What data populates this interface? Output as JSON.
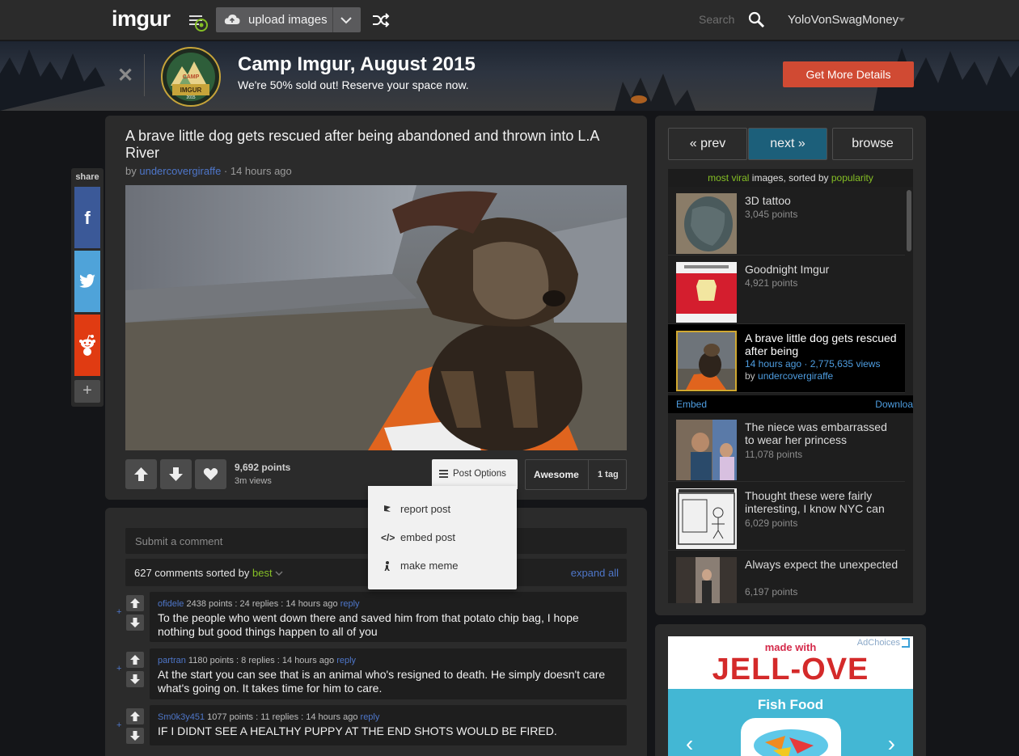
{
  "header": {
    "logo": "imgur",
    "upload_label": "upload images",
    "search_placeholder": "Search",
    "username": "YoloVonSwagMoney"
  },
  "banner": {
    "title": "Camp Imgur, August 2015",
    "subtitle": "We're 50% sold out! Reserve your space now.",
    "button_label": "Get More Details",
    "badge_line1": "CAMP",
    "badge_line2": "IMGUR",
    "badge_line3": "2015"
  },
  "share": {
    "label": "share",
    "plus": "+"
  },
  "post": {
    "title": "A brave little dog gets rescued after being abandoned and thrown into L.A River",
    "by_prefix": "by",
    "author": "undercovergiraffe",
    "time": "· 14 hours ago",
    "points": "9,692 points",
    "views": "3m views",
    "post_options_label": "Post Options",
    "tag_label": "Awesome",
    "tag_count": "1 tag"
  },
  "post_options_menu": [
    {
      "icon": "flag-icon",
      "label": "report post"
    },
    {
      "icon": "code-icon",
      "label": "embed post"
    },
    {
      "icon": "meme-icon",
      "label": "make meme"
    }
  ],
  "comments": {
    "input_placeholder": "Submit a comment",
    "count_text": "627 comments sorted by",
    "sort_value": "best",
    "expand_label": "expand all",
    "items": [
      {
        "user": "ofidele",
        "meta": "2438 points : 24 replies : 14 hours ago",
        "reply": "reply",
        "text": "To the people who went down there and saved him from that potato chip bag, I hope nothing but good things happen to all of you"
      },
      {
        "user": "partran",
        "meta": "1180 points : 8 replies : 14 hours ago",
        "reply": "reply",
        "text": "At the start you can see that is an animal who's resigned to death. He simply doesn't care what's going on. It takes time for him to care."
      },
      {
        "user": "Sm0k3y451",
        "meta": "1077 points : 11 replies : 14 hours ago",
        "reply": "reply",
        "text": "IF I DIDNT SEE A HEALTHY PUPPY AT THE END SHOTS WOULD BE FIRED."
      }
    ]
  },
  "sidebar": {
    "prev_label": "« prev",
    "next_label": "next »",
    "browse_label": "browse",
    "viral_part1": "most viral",
    "viral_part2": " images, sorted by ",
    "viral_part3": "popularity",
    "gallery": [
      {
        "title": "3D tattoo",
        "points": "3,045 points"
      },
      {
        "title": "Goodnight Imgur",
        "points": "4,921 points"
      },
      {
        "title": "A brave little dog gets rescued after being",
        "time_views": "14 hours ago · 2,775,635 views",
        "by": "by",
        "author": "undercovergiraffe"
      },
      {
        "title": "The niece was embarrassed to wear her princess",
        "points": "11,078 points"
      },
      {
        "title": "Thought these were fairly interesting, I know NYC can",
        "points": "6,029 points"
      },
      {
        "title": "Always expect the unexpected",
        "points": "6,197 points"
      }
    ],
    "embed_label": "Embed",
    "download_label": "Downloa"
  },
  "ad": {
    "adchoices": "AdChoices",
    "made_with": "made with",
    "brand": "JELL-OVE",
    "product": "Fish Food"
  },
  "colors": {
    "accent_green": "#85bf25",
    "link_blue": "#4e76c9",
    "banner_button": "#d04a33",
    "next_button": "#1c5f7a"
  }
}
